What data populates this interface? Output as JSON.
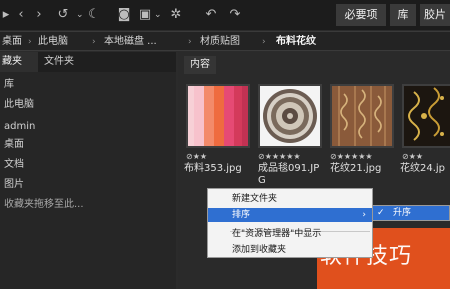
{
  "toolbar": {
    "btn_required": "必要项",
    "btn_library": "库",
    "btn_film": "胶片"
  },
  "breadcrumb": {
    "items": [
      "桌面",
      "此电脑",
      "本地磁盘 ...",
      "材质贴图",
      "布料花纹"
    ]
  },
  "left_panel": {
    "tabs": [
      "藏夹",
      "文件夹"
    ],
    "tree": [
      "库",
      "此电脑",
      "admin",
      "桌面",
      "文档",
      "图片",
      "收藏夹拖移至此..."
    ]
  },
  "right_panel": {
    "tab": "内容",
    "files": [
      {
        "name": "布料353.jpg",
        "stars": "⊘★★"
      },
      {
        "name": "成品毯091.JPG",
        "stars": "⊘★★★★★"
      },
      {
        "name": "花纹21.jpg",
        "stars": "⊘★★★★★"
      },
      {
        "name": "花纹24.jp",
        "stars": "⊘★★"
      }
    ]
  },
  "context_menu": {
    "items": [
      "新建文件夹",
      "排序",
      "在\"资源管理器\"中显示",
      "添加到收藏夹"
    ],
    "submenu_check": "✓",
    "submenu_item": "升序"
  },
  "watermark": "软件技巧",
  "colors": {
    "accent": "#2f6fd1",
    "watermark_bg": "#e0501d",
    "panel_bg": "#2a2a2a"
  }
}
